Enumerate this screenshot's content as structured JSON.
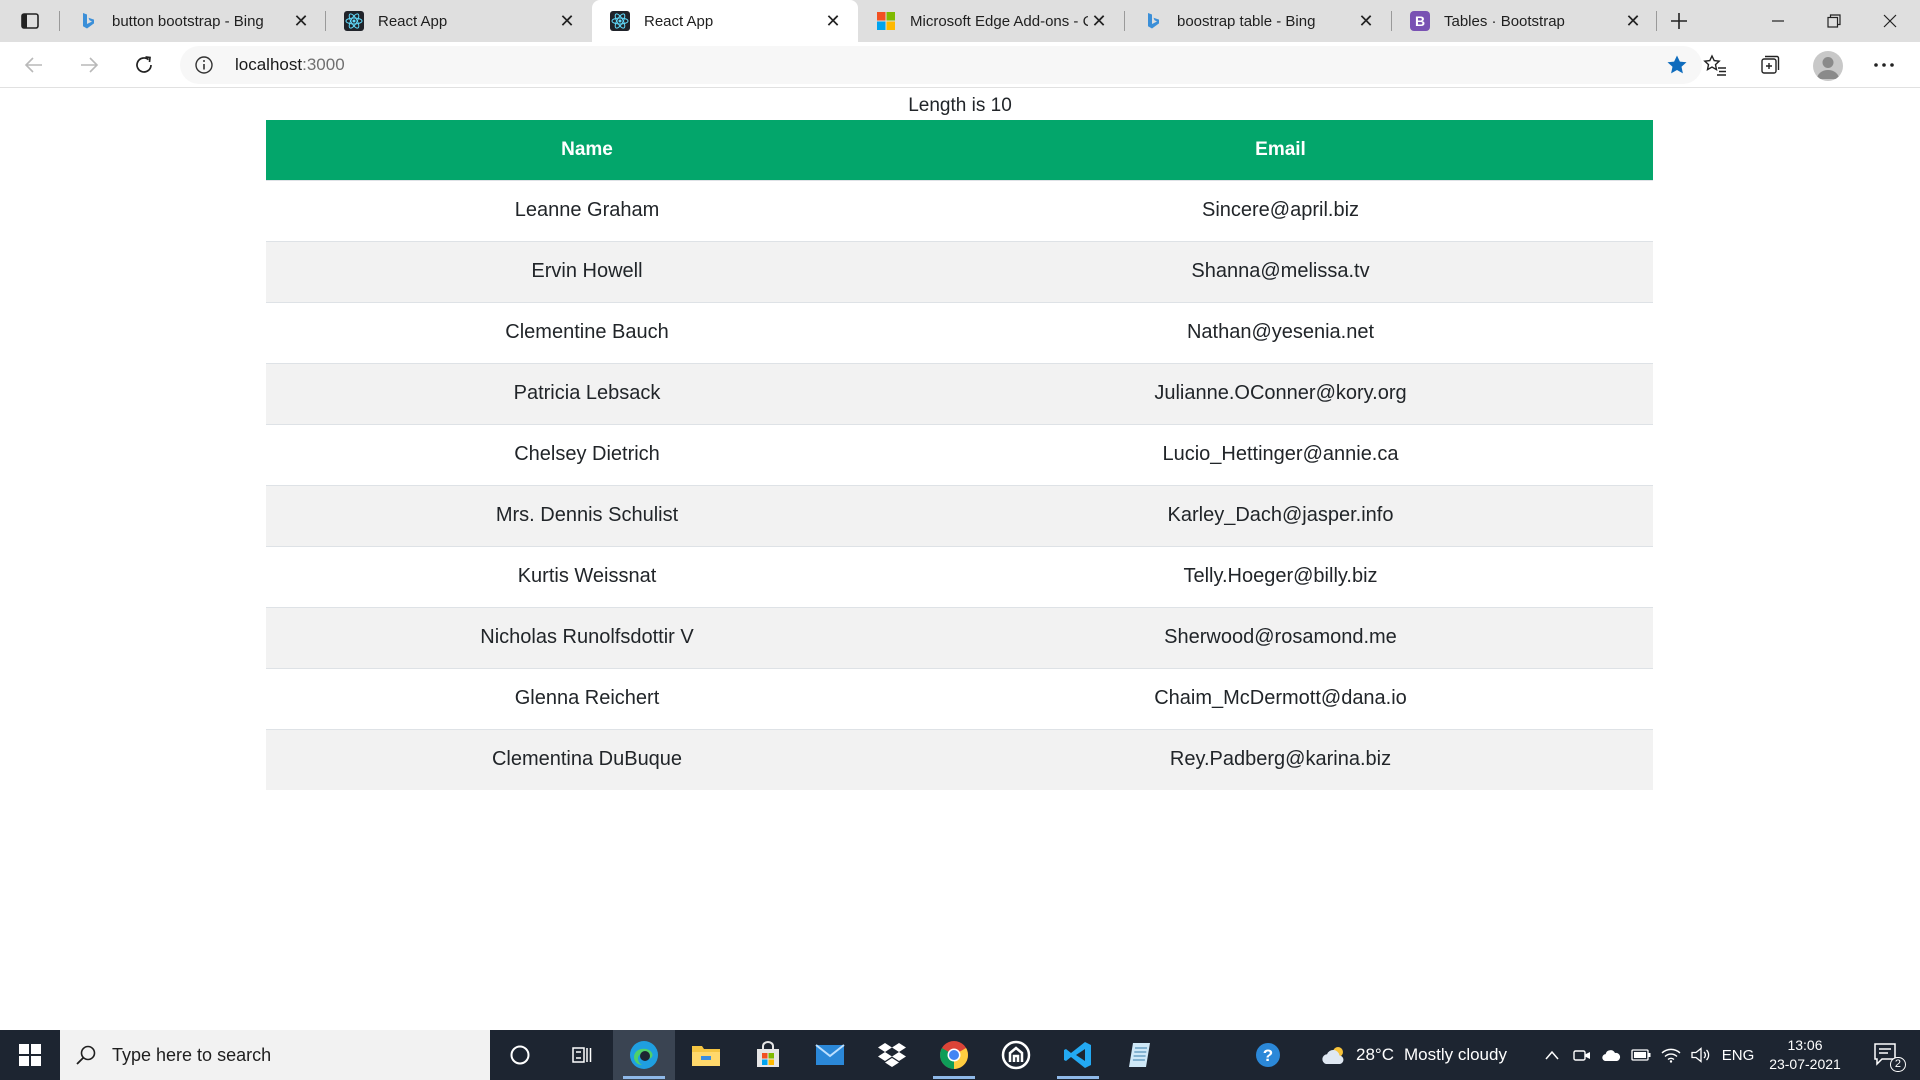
{
  "browser": {
    "tabs": [
      {
        "title": "button bootstrap - Bing",
        "favicon": "bing-icon",
        "active": false
      },
      {
        "title": "React App",
        "favicon": "react-icon",
        "active": false
      },
      {
        "title": "React App",
        "favicon": "react-icon",
        "active": true
      },
      {
        "title": "Microsoft Edge Add-ons - C",
        "favicon": "microsoft-icon",
        "active": false
      },
      {
        "title": "boostrap table - Bing",
        "favicon": "bing-icon",
        "active": false
      },
      {
        "title": "Tables · Bootstrap",
        "favicon": "bootstrap-icon",
        "active": false
      }
    ],
    "address": {
      "host": "localhost",
      "port": ":3000"
    },
    "favorite_star_color": "#0f6cbd"
  },
  "page": {
    "caption": "Length is 10",
    "header_color": "#03a66b",
    "columns": [
      "Name",
      "Email"
    ],
    "rows": [
      {
        "name": "Leanne Graham",
        "email": "Sincere@april.biz"
      },
      {
        "name": "Ervin Howell",
        "email": "Shanna@melissa.tv"
      },
      {
        "name": "Clementine Bauch",
        "email": "Nathan@yesenia.net"
      },
      {
        "name": "Patricia Lebsack",
        "email": "Julianne.OConner@kory.org"
      },
      {
        "name": "Chelsey Dietrich",
        "email": "Lucio_Hettinger@annie.ca"
      },
      {
        "name": "Mrs. Dennis Schulist",
        "email": "Karley_Dach@jasper.info"
      },
      {
        "name": "Kurtis Weissnat",
        "email": "Telly.Hoeger@billy.biz"
      },
      {
        "name": "Nicholas Runolfsdottir V",
        "email": "Sherwood@rosamond.me"
      },
      {
        "name": "Glenna Reichert",
        "email": "Chaim_McDermott@dana.io"
      },
      {
        "name": "Clementina DuBuque",
        "email": "Rey.Padberg@karina.biz"
      }
    ]
  },
  "taskbar": {
    "search_placeholder": "Type here to search",
    "apps": [
      "cortana-icon",
      "task-view-icon",
      "edge-icon",
      "file-explorer-icon",
      "store-icon",
      "mail-icon",
      "dropbox-icon",
      "chrome-icon",
      "app-icon",
      "vscode-icon",
      "notepad-icon"
    ],
    "weather": {
      "temperature": "28°C",
      "condition": "Mostly cloudy"
    },
    "language": "ENG",
    "time": "13:06",
    "date": "23-07-2021",
    "notification_count": "2"
  }
}
